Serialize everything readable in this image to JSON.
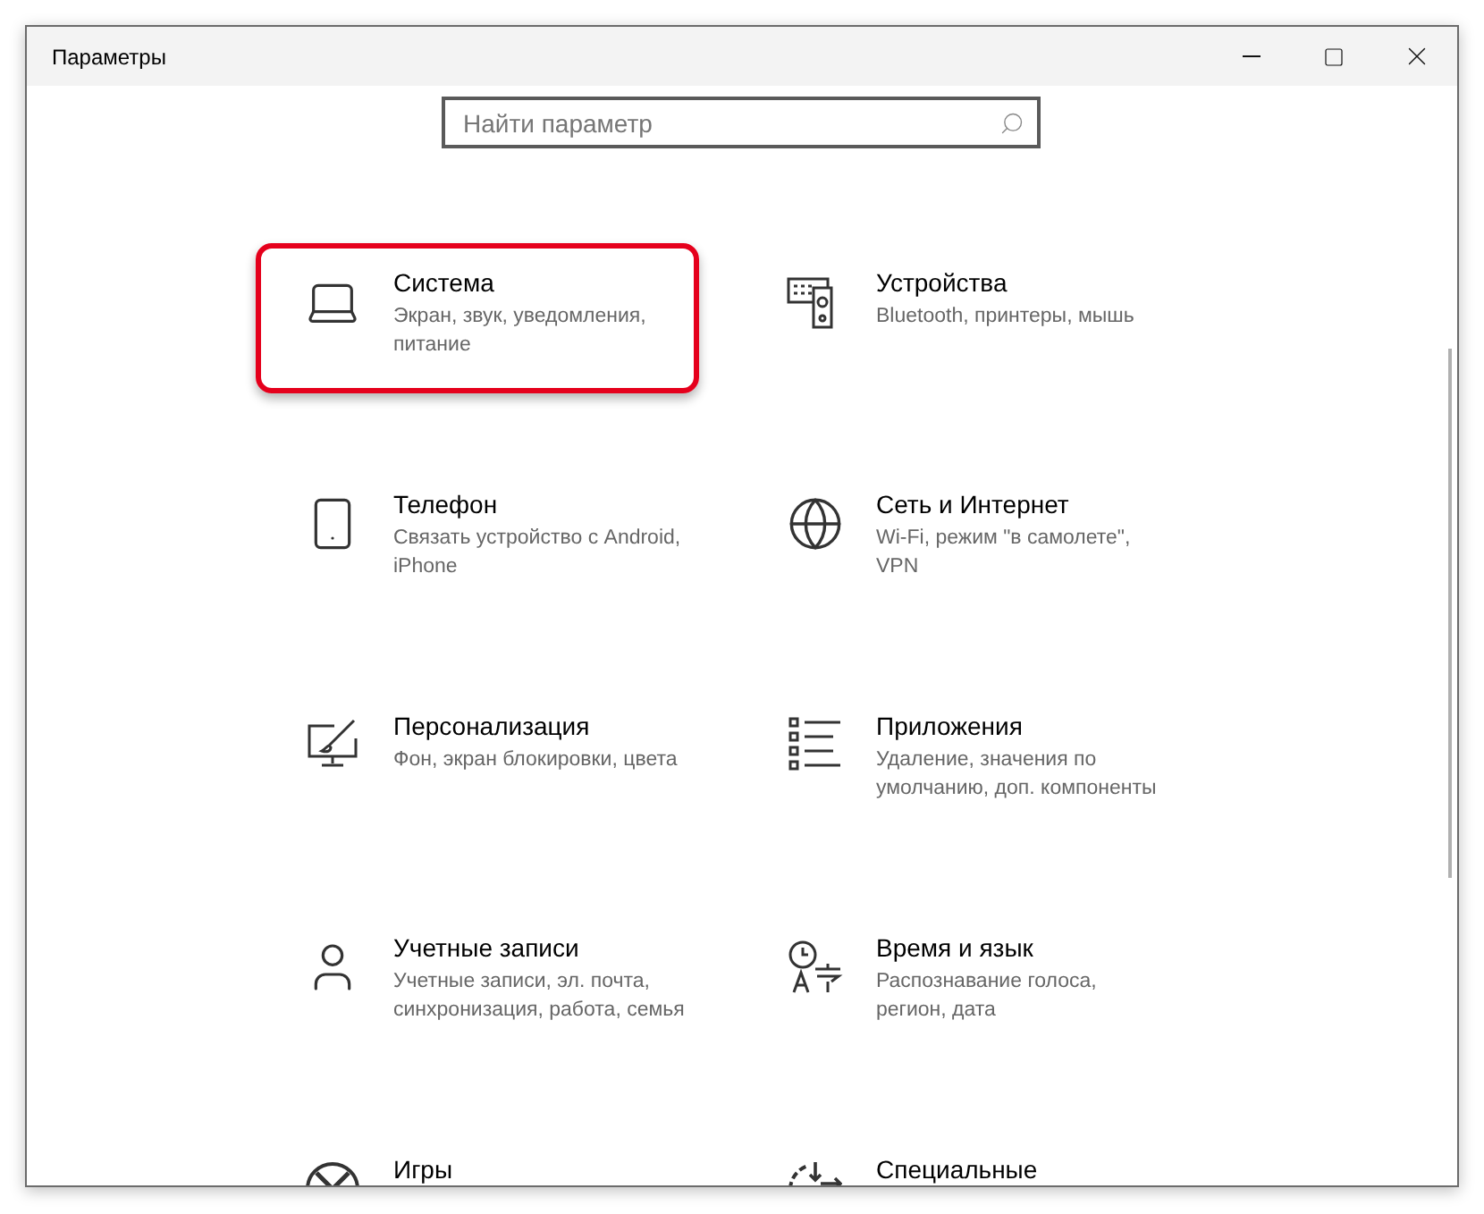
{
  "window": {
    "title": "Параметры"
  },
  "search": {
    "placeholder": "Найти параметр"
  },
  "categories": [
    {
      "title": "Система",
      "subtitle": "Экран, звук, уведомления, питание",
      "highlighted": true
    },
    {
      "title": "Устройства",
      "subtitle": "Bluetooth, принтеры, мышь",
      "highlighted": false
    },
    {
      "title": "Телефон",
      "subtitle": "Связать устройство с Android, iPhone",
      "highlighted": false
    },
    {
      "title": "Сеть и Интернет",
      "subtitle": "Wi-Fi, режим \"в самолете\", VPN",
      "highlighted": false
    },
    {
      "title": "Персонализация",
      "subtitle": "Фон, экран блокировки, цвета",
      "highlighted": false
    },
    {
      "title": "Приложения",
      "subtitle": "Удаление, значения по умолчанию, доп. компоненты",
      "highlighted": false
    },
    {
      "title": "Учетные записи",
      "subtitle": "Учетные записи, эл. почта, синхронизация, работа, семья",
      "highlighted": false
    },
    {
      "title": "Время и язык",
      "subtitle": "Распознавание голоса, регион, дата",
      "highlighted": false
    },
    {
      "title": "Игры",
      "highlighted": false
    },
    {
      "title": "Специальные",
      "highlighted": false
    }
  ]
}
